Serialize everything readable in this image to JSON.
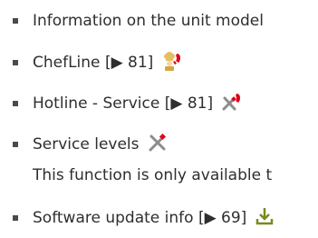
{
  "list": {
    "items": [
      {
        "label": "Information on the unit model"
      },
      {
        "label": "ChefLine",
        "ref": "[▶ 81]",
        "icon": "chef-phone-icon"
      },
      {
        "label": "Hotline - Service",
        "ref": "[▶ 81]",
        "icon": "tools-phone-icon"
      },
      {
        "label": "Service levels",
        "icon": "tools-icon"
      },
      {
        "label": "Software update info",
        "ref": "[▶ 69]",
        "icon": "download-icon"
      }
    ],
    "note": "This function is only available t"
  },
  "colors": {
    "text": "#2e2e2e",
    "accent_red": "#e2001a",
    "chef_gold": "#d8a544",
    "tool_grey": "#8c8c8c",
    "download_green": "#7a8a1e"
  }
}
